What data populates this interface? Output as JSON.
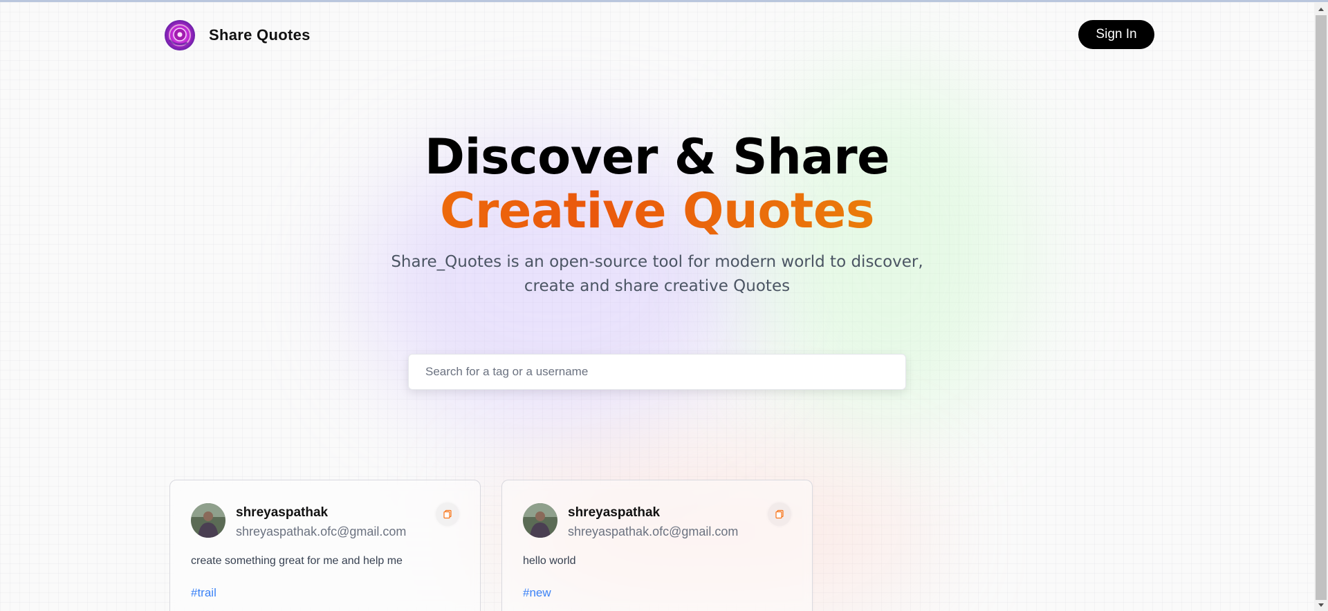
{
  "nav": {
    "brand": "Share Quotes",
    "sign_in_label": "Sign In"
  },
  "hero": {
    "title_line1": "Discover & Share",
    "title_line2": "Creative Quotes",
    "description": "Share_Quotes is an open-source tool for modern world to discover, create and share creative Quotes"
  },
  "search": {
    "placeholder": "Search for a tag or a username",
    "value": ""
  },
  "cards": [
    {
      "username": "shreyaspathak",
      "email": "shreyaspathak.ofc@gmail.com",
      "quote": "create something great for me and help me",
      "tag": "#trail"
    },
    {
      "username": "shreyaspathak",
      "email": "shreyaspathak.ofc@gmail.com",
      "quote": "hello world",
      "tag": "#new"
    }
  ],
  "colors": {
    "accent_gradient": [
      "#f59e0b",
      "#ea580c",
      "#eab308"
    ],
    "tag": "#3b82f6",
    "button_bg": "#000000",
    "copy_icon": "#f97316"
  },
  "icons": {
    "logo": "swirl-logo-icon",
    "copy": "copy-icon"
  }
}
